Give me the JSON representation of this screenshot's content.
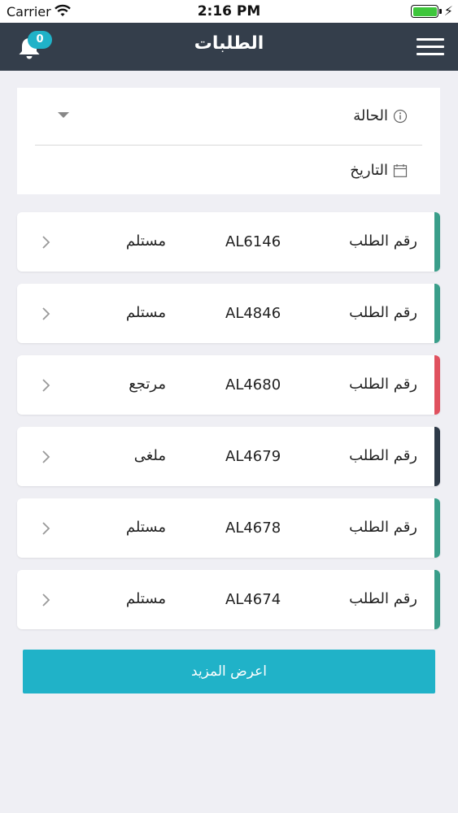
{
  "status_bar": {
    "carrier": "Carrier",
    "time": "2:16 PM"
  },
  "nav": {
    "title": "الطلبات",
    "notification_count": "0",
    "bell_icon": "bell-icon",
    "menu_icon": "hamburger-menu-icon"
  },
  "filters": {
    "status_label": "الحالة",
    "date_label": "التاريخ"
  },
  "orders": [
    {
      "label": "رقم الطلب",
      "number": "AL6146",
      "status": "مستلم",
      "color": "#3a9e8a"
    },
    {
      "label": "رقم الطلب",
      "number": "AL4846",
      "status": "مستلم",
      "color": "#3a9e8a"
    },
    {
      "label": "رقم الطلب",
      "number": "AL4680",
      "status": "مرتجع",
      "color": "#e0515f"
    },
    {
      "label": "رقم الطلب",
      "number": "AL4679",
      "status": "ملغى",
      "color": "#2e3a48"
    },
    {
      "label": "رقم الطلب",
      "number": "AL4678",
      "status": "مستلم",
      "color": "#3a9e8a"
    },
    {
      "label": "رقم الطلب",
      "number": "AL4674",
      "status": "مستلم",
      "color": "#3a9e8a"
    }
  ],
  "more_button": "اعرض المزيد",
  "colors": {
    "nav_bg": "#343e4b",
    "accent": "#20b2c8",
    "received": "#3a9e8a",
    "returned": "#e0515f",
    "cancelled": "#2e3a48"
  }
}
